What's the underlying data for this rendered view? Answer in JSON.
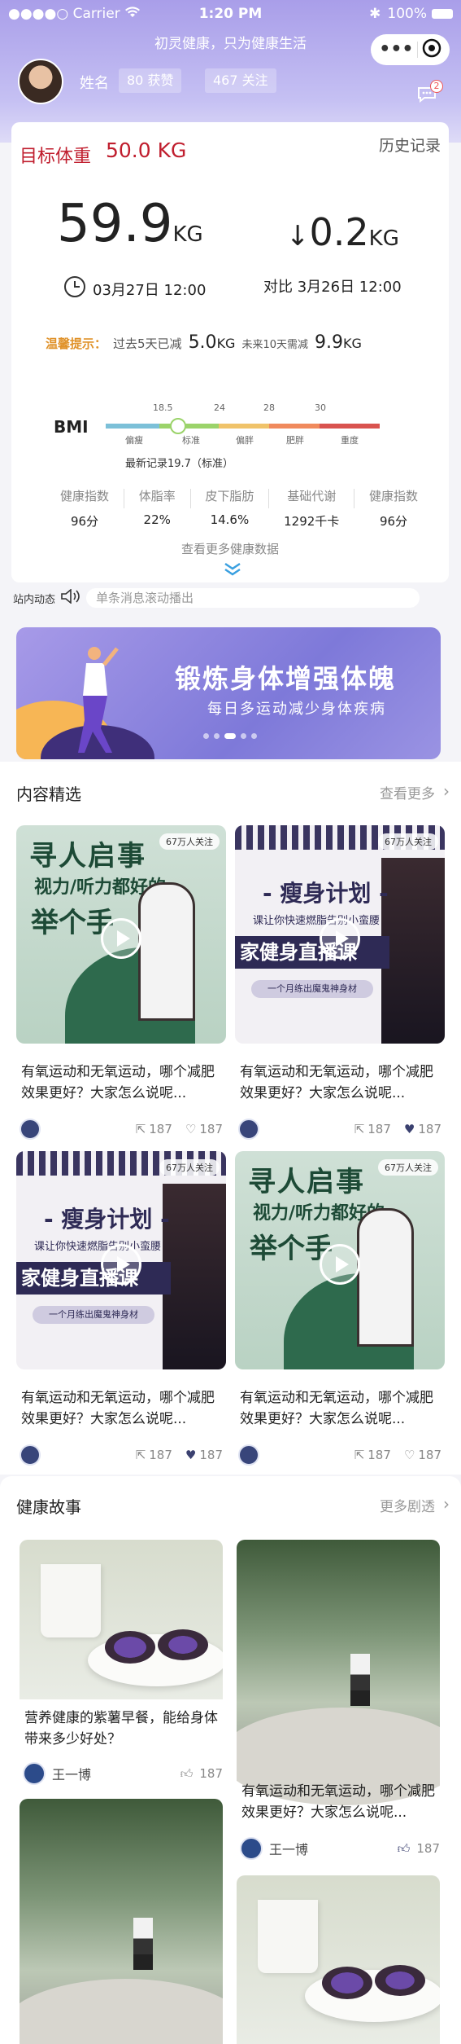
{
  "status_bar": {
    "carrier": "●●●●○ Carrier",
    "time": "1:20 PM",
    "battery": "100%"
  },
  "header": {
    "slogan": "初灵健康，只为健康生活",
    "user_name": "姓名",
    "likes": "80 获赞",
    "follows": "467 关注",
    "msg_count": "2"
  },
  "weight": {
    "target_label": "目标体重",
    "target_value": "50.0 KG",
    "history_label": "历史记录",
    "current_value": "59.9",
    "current_unit": "KG",
    "diff_value": "0.2",
    "diff_unit": "KG",
    "current_date": "03月27日 12:00",
    "compare_date": "对比 3月26日 12:00",
    "tip_title": "温馨提示：",
    "tip_lost_label": "过去5天已减",
    "tip_lost_value": "5.0",
    "tip_lost_unit": "KG",
    "tip_need_label": "未来10天需减",
    "tip_need_value": "9.9",
    "tip_need_unit": "KG"
  },
  "bmi": {
    "label": "BMI",
    "ticks": [
      "18.5",
      "24",
      "28",
      "30"
    ],
    "categories": [
      "偏瘦",
      "标准",
      "偏胖",
      "肥胖",
      "重度"
    ],
    "segment_colors": [
      "#7cc0d8",
      "#9bd36a",
      "#f0c36a",
      "#f08a5d",
      "#d9534f"
    ],
    "record": "最新记录19.7（标准）"
  },
  "metrics": [
    {
      "label": "健康指数",
      "value": "96分"
    },
    {
      "label": "体脂率",
      "value": "22%"
    },
    {
      "label": "皮下脂肪",
      "value": "14.6%"
    },
    {
      "label": "基础代谢",
      "value": "1292千卡"
    },
    {
      "label": "健康指数",
      "value": "96分"
    }
  ],
  "more_health_data": "查看更多健康数据",
  "news": {
    "label": "站内动态",
    "placeholder": "单条消息滚动播出"
  },
  "banner": {
    "title": "锻炼身体增强体魄",
    "subtitle": "每日多运动减少身体疾病"
  },
  "featured": {
    "title": "内容精选",
    "more": "查看更多",
    "cards": [
      {
        "thumb": "green",
        "follow": "67万人关注",
        "title": "有氧运动和无氧运动，哪个减肥效果更好？大家怎么说呢...",
        "shares": "187",
        "likes": "187",
        "liked": false,
        "t1": "寻人启事",
        "t2": "视力/听力都好的",
        "t3": "举个手"
      },
      {
        "thumb": "dark",
        "follow": "67万人关注",
        "title": "有氧运动和无氧运动，哪个减肥效果更好？大家怎么说呢...",
        "shares": "187",
        "likes": "187",
        "liked": true,
        "t1": "- 瘦身计划 -",
        "t2": "课让你快速燃脂告别小蛮腰",
        "t3": "家健身直播课",
        "t4": "一个月练出魔鬼神身材"
      },
      {
        "thumb": "dark",
        "follow": "67万人关注",
        "title": "有氧运动和无氧运动，哪个减肥效果更好？大家怎么说呢...",
        "shares": "187",
        "likes": "187",
        "liked": true,
        "t1": "- 瘦身计划 -",
        "t2": "课让你快速燃脂告别小蛮腰",
        "t3": "家健身直播课",
        "t4": "一个月练出魔鬼神身材"
      },
      {
        "thumb": "green",
        "follow": "67万人关注",
        "title": "有氧运动和无氧运动，哪个减肥效果更好？大家怎么说呢...",
        "shares": "187",
        "likes": "187",
        "liked": false,
        "t1": "寻人启事",
        "t2": "视力/听力都好的",
        "t3": "举个手"
      }
    ]
  },
  "stories": {
    "title": "健康故事",
    "more": "更多剧透",
    "items": [
      {
        "title": "营养健康的紫薯早餐，能给身体带来多少好处？",
        "author": "王一博",
        "likes": "187",
        "liked": false
      },
      {
        "title": "有氧运动和无氧运动，哪个减肥效果更好？大家怎么说呢...",
        "author": "王一博",
        "likes": "187",
        "liked": true
      }
    ]
  },
  "colors": {
    "accent": "#c01e2e",
    "header": "#a99ee9",
    "tip": "#e0922a",
    "like": "#3b4170"
  }
}
